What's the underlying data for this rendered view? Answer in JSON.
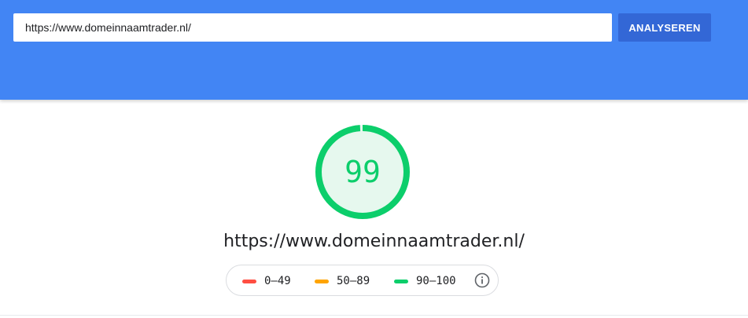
{
  "search": {
    "url_value": "https://www.domeinnaamtrader.nl/",
    "analyze_label": "ANALYSEREN"
  },
  "score": {
    "value": "99",
    "fraction": 0.99,
    "color": "#0cce6b",
    "fill_color": "#e6f8ee"
  },
  "tested_url": "https://www.domeinnaamtrader.nl/",
  "legend": {
    "items": [
      {
        "label": "0–49",
        "color": "#ff4e42"
      },
      {
        "label": "50–89",
        "color": "#ffa400"
      },
      {
        "label": "90–100",
        "color": "#0cce6b"
      }
    ],
    "info_icon": "info-icon"
  },
  "colors": {
    "header_bg": "#4285f4",
    "button_bg": "#3367d6"
  }
}
